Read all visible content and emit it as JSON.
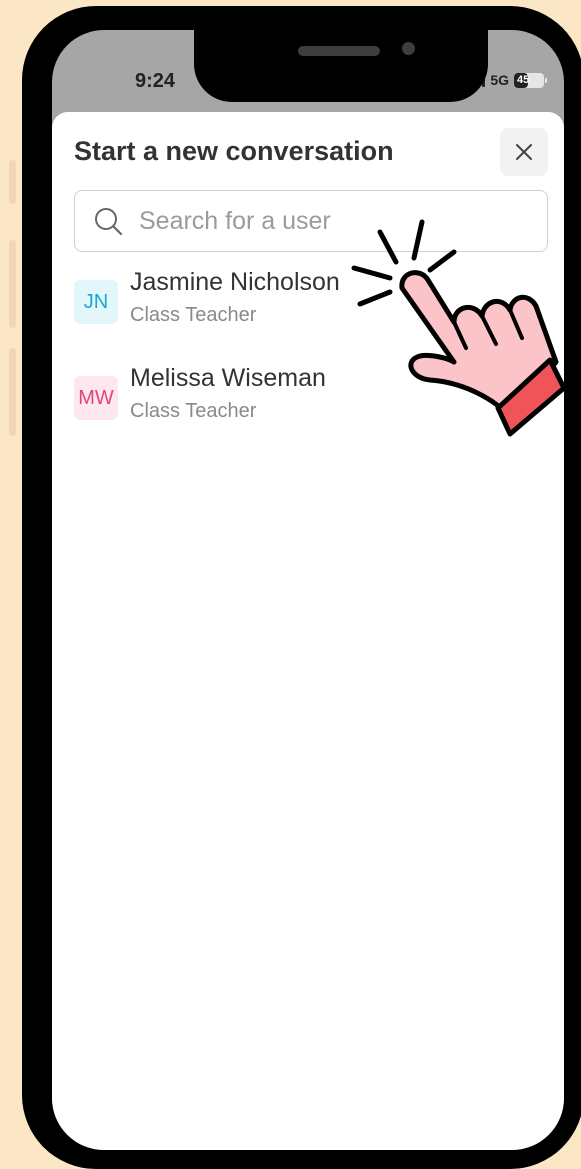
{
  "status_bar": {
    "time": "9:24",
    "network": "5G",
    "battery": "45",
    "battery_level": 0.45
  },
  "dialog": {
    "title": "Start a new conversation",
    "close_icon": "close-icon"
  },
  "search": {
    "placeholder": "Search for a user",
    "value": "",
    "icon": "search-icon"
  },
  "users": [
    {
      "initials": "JN",
      "name": "Jasmine Nicholson",
      "role": "Class Teacher",
      "avatar_bg": "#e3f6fb",
      "avatar_fg": "#1aa6cf"
    },
    {
      "initials": "MW",
      "name": "Melissa Wiseman",
      "role": "Class Teacher",
      "avatar_bg": "#fde8ef",
      "avatar_fg": "#e0457b"
    }
  ],
  "colors": {
    "background": "#fbe7c6",
    "phone_frame": "#000000",
    "hand_fill": "#fbc4c8",
    "cuff": "#f05459"
  },
  "overlay": {
    "icon": "pointing-hand-icon"
  }
}
